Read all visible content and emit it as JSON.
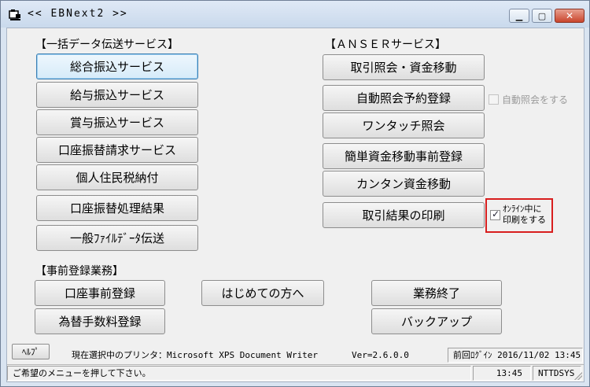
{
  "window": {
    "title": "<< EBNext2 >>"
  },
  "sections": {
    "bulk": "【一括データ伝送サービス】",
    "anser": "【ＡＮＳＥＲサービス】",
    "pre": "【事前登録業務】"
  },
  "bulk_buttons": [
    "総合振込サービス",
    "給与振込サービス",
    "賞与振込サービス",
    "口座振替請求サービス",
    "個人住民税納付",
    "口座振替処理結果",
    "一般ﾌｧｲﾙﾃﾞｰﾀ伝送"
  ],
  "anser_buttons": [
    "取引照会・資金移動",
    "自動照会予約登録",
    "ワンタッチ照会",
    "簡単資金移動事前登録",
    "カンタン資金移動",
    "取引結果の印刷"
  ],
  "auto_inquiry": {
    "label": "自動照会をする",
    "checked": false
  },
  "print_online": {
    "line1": "ｵﾝﾗｲﾝ中に",
    "line2": "印刷をする",
    "checked": true
  },
  "pre_buttons": {
    "account_register": "口座事前登録",
    "fee_register": "為替手数料登録"
  },
  "first_time": "はじめての方へ",
  "exit": "業務終了",
  "backup": "バックアップ",
  "help": "ﾍﾙﾌﾟ",
  "info": {
    "printer": "現在選択中のプリンタ：Microsoft XPS Document Writer",
    "version": "Ver=2.6.0.0",
    "last_login": "前回ﾛｸﾞｲﾝ 2016/11/02 13:45"
  },
  "status": {
    "message": "ご希望のメニューを押して下さい。",
    "time": "13:45",
    "user": "NTTDSYS"
  },
  "colors": {
    "highlight_border": "#d81e1e",
    "focus_border": "#3c7fb1"
  }
}
